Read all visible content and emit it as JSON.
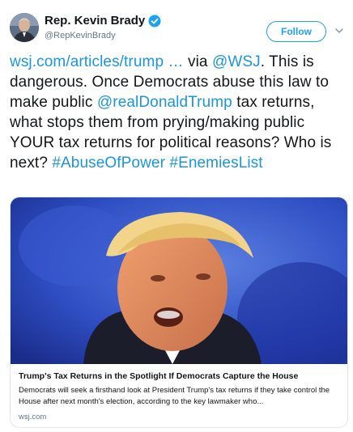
{
  "author": {
    "display_name": "Rep. Kevin Brady",
    "handle": "@RepKevinBrady",
    "avatar": "person-avatar",
    "verified_icon": "verified-badge-icon"
  },
  "actions": {
    "follow_label": "Follow",
    "more_icon": "chevron-down-icon"
  },
  "tweet": {
    "link": "wsj.com/articles/trump   …",
    "via": " via ",
    "mention_wsj": "@WSJ",
    "text_1": ". This is dangerous. Once Democrats abuse this law to make public ",
    "mention_trump": "@realDonaldTrump",
    "text_2": " tax returns, what stops them from prying/making public YOUR tax returns for political reasons? Who is next? ",
    "hashtag_1": "#AbuseOfPower",
    "space": " ",
    "hashtag_2": "#EnemiesList"
  },
  "card": {
    "title": "Trump's Tax Returns in the Spotlight If Democrats Capture the House",
    "description": "Democrats will seek a firsthand look at President Trump's tax returns if they take control the House after next month's election, according to the key lawmaker who...",
    "domain": "wsj.com",
    "image": "speaker-photo"
  },
  "colors": {
    "link": "#1b95e0",
    "accent": "#1da1f2",
    "text": "#14171a",
    "secondary": "#657786",
    "border": "#e1e8ed"
  }
}
